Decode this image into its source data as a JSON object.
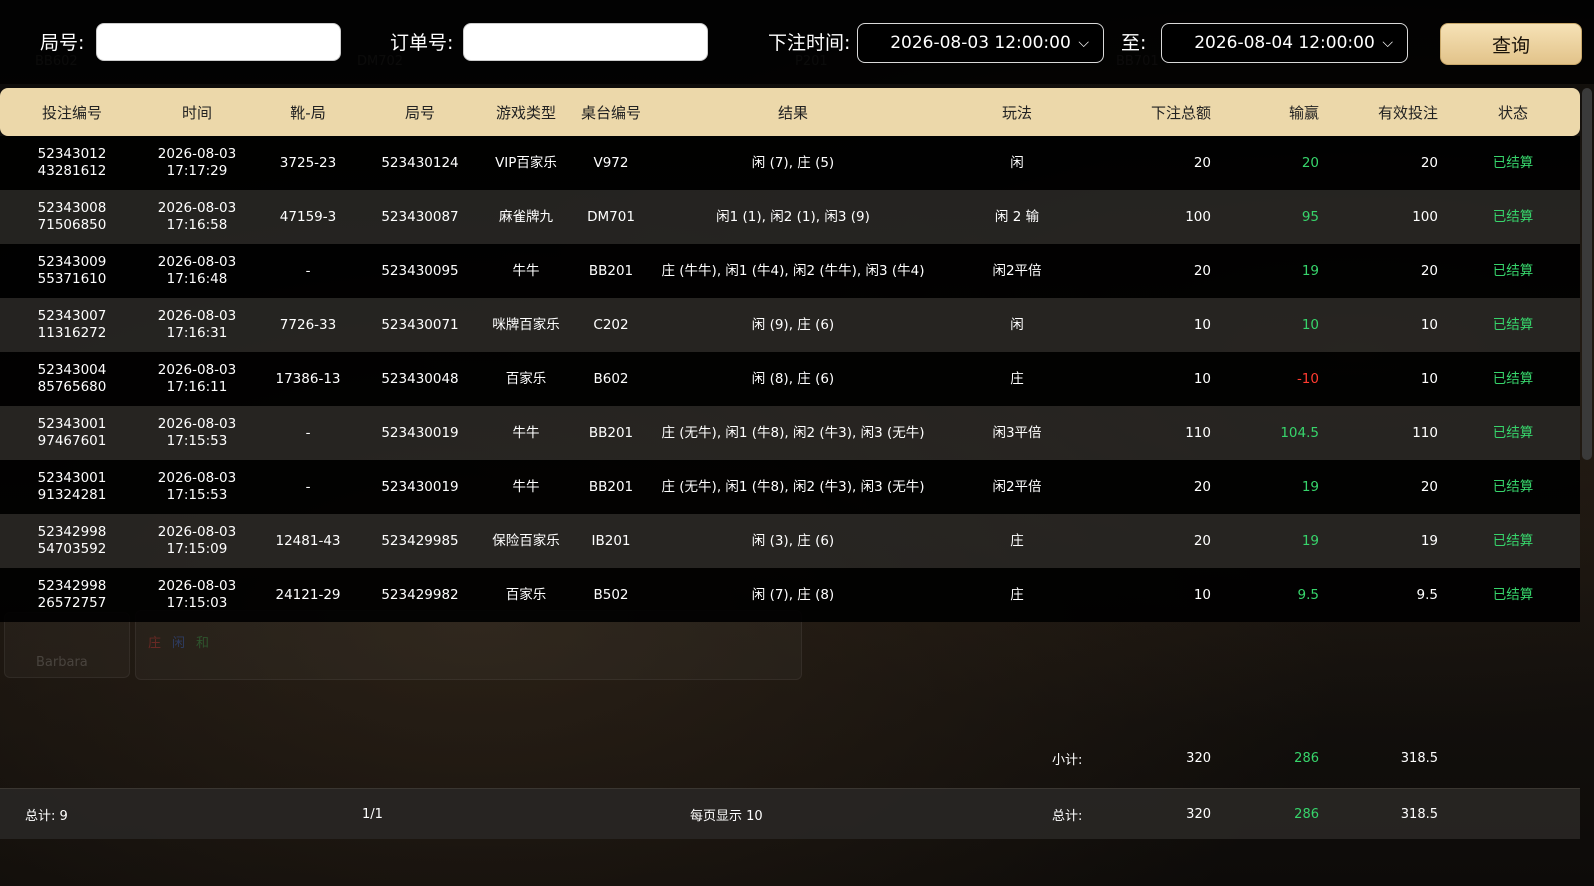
{
  "filters": {
    "round_label": "局号:",
    "round_value": "",
    "order_label": "订单号:",
    "order_value": "",
    "time_label": "下注时间:",
    "start_time": "2026-08-03 12:00:00",
    "to_label": "至:",
    "end_time": "2026-08-04 12:00:00",
    "query_label": "查询"
  },
  "table": {
    "headers": [
      "投注编号",
      "时间",
      "靴-局",
      "局号",
      "游戏类型",
      "桌台编号",
      "结果",
      "玩法",
      "下注总额",
      "输赢",
      "有效投注",
      "状态"
    ],
    "rows": [
      {
        "id_line1": "52343012",
        "id_line2": "43281612",
        "date": "2026-08-03",
        "time": "17:17:29",
        "shoe": "3725-23",
        "round": "523430124",
        "game": "VIP百家乐",
        "table": "V972",
        "result": "闲 (7), 庄 (5)",
        "play": "闲",
        "bet": "20",
        "win": "20",
        "valid": "20",
        "status": "已结算"
      },
      {
        "id_line1": "52343008",
        "id_line2": "71506850",
        "date": "2026-08-03",
        "time": "17:16:58",
        "shoe": "47159-3",
        "round": "523430087",
        "game": "麻雀牌九",
        "table": "DM701",
        "result": "闲1 (1), 闲2 (1), 闲3 (9)",
        "play": "闲 2 输",
        "bet": "100",
        "win": "95",
        "valid": "100",
        "status": "已结算"
      },
      {
        "id_line1": "52343009",
        "id_line2": "55371610",
        "date": "2026-08-03",
        "time": "17:16:48",
        "shoe": "-",
        "round": "523430095",
        "game": "牛牛",
        "table": "BB201",
        "result": "庄 (牛牛), 闲1 (牛4), 闲2 (牛牛), 闲3 (牛4)",
        "play": "闲2平倍",
        "bet": "20",
        "win": "19",
        "valid": "20",
        "status": "已结算"
      },
      {
        "id_line1": "52343007",
        "id_line2": "11316272",
        "date": "2026-08-03",
        "time": "17:16:31",
        "shoe": "7726-33",
        "round": "523430071",
        "game": "咪牌百家乐",
        "table": "C202",
        "result": "闲 (9), 庄 (6)",
        "play": "闲",
        "bet": "10",
        "win": "10",
        "valid": "10",
        "status": "已结算"
      },
      {
        "id_line1": "52343004",
        "id_line2": "85765680",
        "date": "2026-08-03",
        "time": "17:16:11",
        "shoe": "17386-13",
        "round": "523430048",
        "game": "百家乐",
        "table": "B602",
        "result": "闲 (8), 庄 (6)",
        "play": "庄",
        "bet": "10",
        "win": "-10",
        "valid": "10",
        "status": "已结算"
      },
      {
        "id_line1": "52343001",
        "id_line2": "97467601",
        "date": "2026-08-03",
        "time": "17:15:53",
        "shoe": "-",
        "round": "523430019",
        "game": "牛牛",
        "table": "BB201",
        "result": "庄 (无牛), 闲1 (牛8), 闲2 (牛3), 闲3 (无牛)",
        "play": "闲3平倍",
        "bet": "110",
        "win": "104.5",
        "valid": "110",
        "status": "已结算"
      },
      {
        "id_line1": "52343001",
        "id_line2": "91324281",
        "date": "2026-08-03",
        "time": "17:15:53",
        "shoe": "-",
        "round": "523430019",
        "game": "牛牛",
        "table": "BB201",
        "result": "庄 (无牛), 闲1 (牛8), 闲2 (牛3), 闲3 (无牛)",
        "play": "闲2平倍",
        "bet": "20",
        "win": "19",
        "valid": "20",
        "status": "已结算"
      },
      {
        "id_line1": "52342998",
        "id_line2": "54703592",
        "date": "2026-08-03",
        "time": "17:15:09",
        "shoe": "12481-43",
        "round": "523429985",
        "game": "保险百家乐",
        "table": "IB201",
        "result": "闲 (3), 庄 (6)",
        "play": "庄",
        "bet": "20",
        "win": "19",
        "valid": "19",
        "status": "已结算"
      },
      {
        "id_line1": "52342998",
        "id_line2": "26572757",
        "date": "2026-08-03",
        "time": "17:15:03",
        "shoe": "24121-29",
        "round": "523429982",
        "game": "百家乐",
        "table": "B502",
        "result": "闲 (7), 庄 (8)",
        "play": "庄",
        "bet": "10",
        "win": "9.5",
        "valid": "9.5",
        "status": "已结算"
      }
    ]
  },
  "subtotal": {
    "label": "小计:",
    "bet": "320",
    "win": "286",
    "valid": "318.5"
  },
  "footer": {
    "count_label": "总计: 9",
    "page": "1/1",
    "per_page": "每页显示 10",
    "total_label": "总计:",
    "bet": "320",
    "win": "286",
    "valid": "318.5"
  },
  "background": {
    "labels": [
      "BB602",
      "DM702",
      "P201",
      "BB701",
      "Barbara",
      "庄",
      "闲",
      "和"
    ]
  },
  "colors": {
    "header_bg": "#ecd8aa",
    "win": "#37d46b",
    "loss": "#ff3b30",
    "button": "#e8c992"
  }
}
